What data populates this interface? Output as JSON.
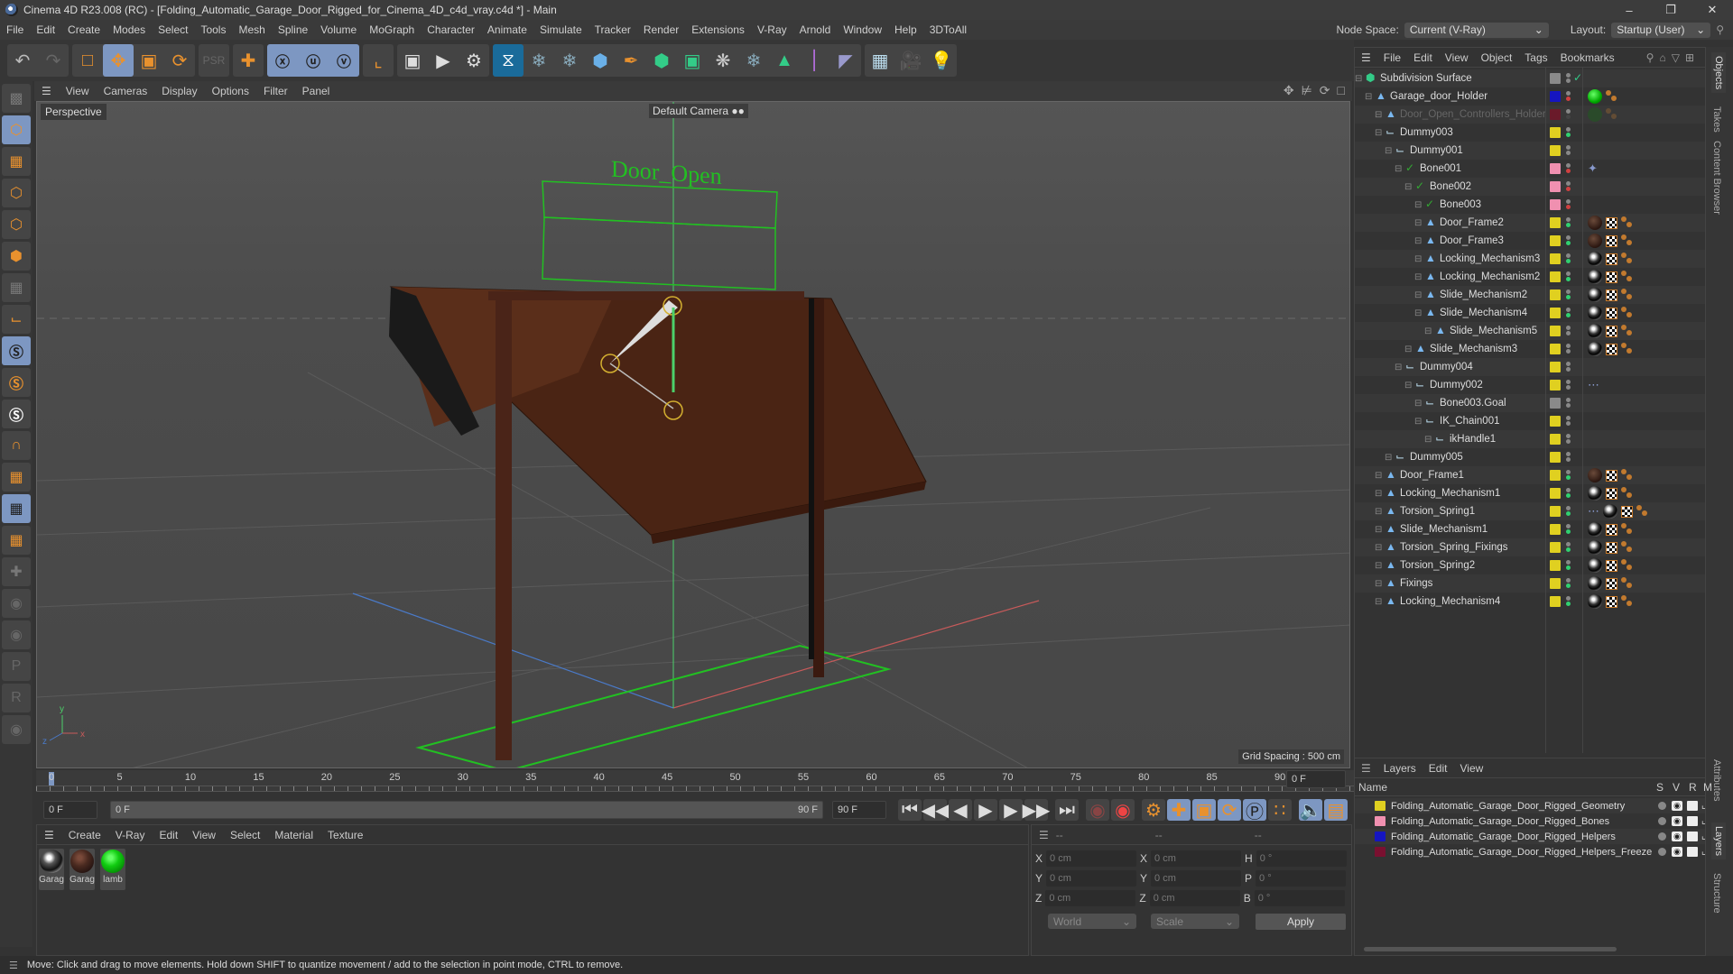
{
  "window": {
    "title": "Cinema 4D R23.008 (RC) - [Folding_Automatic_Garage_Door_Rigged_for_Cinema_4D_c4d_vray.c4d *] - Main",
    "controls": [
      "minimize",
      "restore",
      "close"
    ]
  },
  "menubar": {
    "items": [
      "File",
      "Edit",
      "Create",
      "Modes",
      "Select",
      "Tools",
      "Mesh",
      "Spline",
      "Volume",
      "MoGraph",
      "Character",
      "Animate",
      "Simulate",
      "Tracker",
      "Render",
      "Extensions",
      "V-Ray",
      "Arnold",
      "Window",
      "Help",
      "3DToAll"
    ],
    "node_space_label": "Node Space:",
    "node_space_value": "Current (V-Ray)",
    "layout_label": "Layout:",
    "layout_value": "Startup (User)"
  },
  "toolbar": {
    "icons": [
      "undo-icon",
      "redo-icon",
      "live-selection-icon",
      "move-icon",
      "scale-icon",
      "rotate-icon",
      "psr-icon",
      "coordinate-move-icon",
      "x-axis-icon",
      "y-axis-icon",
      "z-axis-icon",
      "world-coordinates-icon",
      "render-view-icon",
      "render-picture-viewer-icon",
      "render-settings-icon",
      "vray-icon",
      "python-icon",
      "python2-icon",
      "cube-icon",
      "pen-icon",
      "subdivision-icon",
      "extrude-icon",
      "cloner-icon",
      "python3-icon",
      "mograph-icon",
      "deformer-icon",
      "bend-icon",
      "floor-icon",
      "camera-icon",
      "light-icon"
    ]
  },
  "viewport": {
    "menu": [
      "View",
      "Cameras",
      "Display",
      "Options",
      "Filter",
      "Panel"
    ],
    "label": "Perspective",
    "camera_label": "Default Camera",
    "grid_spacing": "Grid Spacing : 500 cm",
    "text_object": "Door_Open"
  },
  "timeline": {
    "ticks": [
      "0",
      "5",
      "10",
      "15",
      "20",
      "25",
      "30",
      "35",
      "40",
      "45",
      "50",
      "55",
      "60",
      "65",
      "70",
      "75",
      "80",
      "85",
      "90"
    ],
    "current_frame": "0 F",
    "start_frame": "0 F",
    "range_start": "0 F",
    "range_end": "90 F",
    "end_frame": "90 F"
  },
  "material_manager": {
    "menu": [
      "Create",
      "V-Ray",
      "Edit",
      "View",
      "Select",
      "Material",
      "Texture"
    ],
    "materials": [
      {
        "label": "Garag",
        "color": "chrome"
      },
      {
        "label": "Garag",
        "color": "brown"
      },
      {
        "label": "lamb",
        "color": "green"
      }
    ]
  },
  "coordinates": {
    "headers": [
      "--",
      "--",
      "--"
    ],
    "rows": [
      {
        "l1": "X",
        "v1": "0 cm",
        "l2": "X",
        "v2": "0 cm",
        "l3": "H",
        "v3": "0 °"
      },
      {
        "l1": "Y",
        "v1": "0 cm",
        "l2": "Y",
        "v2": "0 cm",
        "l3": "P",
        "v3": "0 °"
      },
      {
        "l1": "Z",
        "v1": "0 cm",
        "l2": "Z",
        "v2": "0 cm",
        "l3": "B",
        "v3": "0 °"
      }
    ],
    "space": "World",
    "mode": "Scale",
    "apply": "Apply"
  },
  "object_manager": {
    "menu": [
      "File",
      "Edit",
      "View",
      "Object",
      "Tags",
      "Bookmarks"
    ],
    "objects": [
      {
        "name": "Subdivision Surface",
        "depth": 0,
        "type": "subdiv",
        "swatch": "#8a8a8a",
        "dot": "check",
        "tags": []
      },
      {
        "name": "Garage_door_Holder",
        "depth": 1,
        "type": "null",
        "swatch": "#1515c0",
        "dot": "red",
        "tags": [
          "green",
          "uv"
        ]
      },
      {
        "name": "Door_Open_Controllers_Holder",
        "depth": 2,
        "type": "null",
        "swatch": "#6a1a2a",
        "dot": "dim",
        "tags": [
          "green-dim",
          "uv-dim"
        ],
        "dimmed": true
      },
      {
        "name": "Dummy003",
        "depth": 2,
        "type": "dummy",
        "swatch": "#e0d020",
        "dot": "green",
        "tags": []
      },
      {
        "name": "Dummy001",
        "depth": 3,
        "type": "dummy",
        "swatch": "#e0d020",
        "dot": "grey",
        "tags": []
      },
      {
        "name": "Bone001",
        "depth": 4,
        "type": "bone",
        "swatch": "#f090b0",
        "dot": "red",
        "tags": [
          "ik"
        ]
      },
      {
        "name": "Bone002",
        "depth": 5,
        "type": "bone",
        "swatch": "#f090b0",
        "dot": "red",
        "tags": []
      },
      {
        "name": "Bone003",
        "depth": 6,
        "type": "bone",
        "swatch": "#f090b0",
        "dot": "red",
        "tags": []
      },
      {
        "name": "Door_Frame2",
        "depth": 6,
        "type": "poly",
        "swatch": "#e0d020",
        "dot": "green",
        "tags": [
          "brown",
          "chk",
          "uv"
        ]
      },
      {
        "name": "Door_Frame3",
        "depth": 6,
        "type": "poly",
        "swatch": "#e0d020",
        "dot": "green",
        "tags": [
          "brown",
          "chk",
          "uv"
        ]
      },
      {
        "name": "Locking_Mechanism3",
        "depth": 6,
        "type": "poly",
        "swatch": "#e0d020",
        "dot": "green",
        "tags": [
          "chrome",
          "chk",
          "uv"
        ]
      },
      {
        "name": "Locking_Mechanism2",
        "depth": 6,
        "type": "poly",
        "swatch": "#e0d020",
        "dot": "green",
        "tags": [
          "chrome",
          "chk",
          "uv"
        ]
      },
      {
        "name": "Slide_Mechanism2",
        "depth": 6,
        "type": "poly",
        "swatch": "#e0d020",
        "dot": "green",
        "tags": [
          "chrome",
          "chk",
          "uv"
        ]
      },
      {
        "name": "Slide_Mechanism4",
        "depth": 6,
        "type": "poly",
        "swatch": "#e0d020",
        "dot": "green",
        "tags": [
          "chrome",
          "chk",
          "uv"
        ]
      },
      {
        "name": "Slide_Mechanism5",
        "depth": 7,
        "type": "poly",
        "swatch": "#e0d020",
        "dot": "grey",
        "tags": [
          "chrome",
          "chk",
          "uv"
        ]
      },
      {
        "name": "Slide_Mechanism3",
        "depth": 5,
        "type": "poly",
        "swatch": "#e0d020",
        "dot": "grey",
        "tags": [
          "chrome",
          "chk",
          "uv"
        ]
      },
      {
        "name": "Dummy004",
        "depth": 4,
        "type": "dummy",
        "swatch": "#e0d020",
        "dot": "grey",
        "tags": []
      },
      {
        "name": "Dummy002",
        "depth": 5,
        "type": "dummy",
        "swatch": "#e0d020",
        "dot": "grey",
        "tags": [
          "constraint"
        ]
      },
      {
        "name": "Bone003.Goal",
        "depth": 6,
        "type": "dummy",
        "swatch": "#8a8a8a",
        "dot": "grey",
        "tags": []
      },
      {
        "name": "IK_Chain001",
        "depth": 6,
        "type": "dummy",
        "swatch": "#e0d020",
        "dot": "grey",
        "tags": []
      },
      {
        "name": "ikHandle1",
        "depth": 7,
        "type": "dummy",
        "swatch": "#e0d020",
        "dot": "grey",
        "tags": []
      },
      {
        "name": "Dummy005",
        "depth": 3,
        "type": "dummy",
        "swatch": "#e0d020",
        "dot": "grey",
        "tags": []
      },
      {
        "name": "Door_Frame1",
        "depth": 2,
        "type": "poly",
        "swatch": "#e0d020",
        "dot": "green",
        "tags": [
          "brown",
          "chk",
          "uv"
        ]
      },
      {
        "name": "Locking_Mechanism1",
        "depth": 2,
        "type": "poly",
        "swatch": "#e0d020",
        "dot": "green",
        "tags": [
          "chrome",
          "chk",
          "uv"
        ]
      },
      {
        "name": "Torsion_Spring1",
        "depth": 2,
        "type": "poly",
        "swatch": "#e0d020",
        "dot": "green",
        "tags": [
          "constraint",
          "chrome",
          "chk",
          "uv"
        ]
      },
      {
        "name": "Slide_Mechanism1",
        "depth": 2,
        "type": "poly",
        "swatch": "#e0d020",
        "dot": "green",
        "tags": [
          "chrome",
          "chk",
          "uv"
        ]
      },
      {
        "name": "Torsion_Spring_Fixings",
        "depth": 2,
        "type": "poly",
        "swatch": "#e0d020",
        "dot": "green",
        "tags": [
          "chrome",
          "chk",
          "uv"
        ]
      },
      {
        "name": "Torsion_Spring2",
        "depth": 2,
        "type": "poly",
        "swatch": "#e0d020",
        "dot": "green",
        "tags": [
          "chrome",
          "chk",
          "uv"
        ]
      },
      {
        "name": "Fixings",
        "depth": 2,
        "type": "poly",
        "swatch": "#e0d020",
        "dot": "green",
        "tags": [
          "chrome",
          "chk",
          "uv"
        ]
      },
      {
        "name": "Locking_Mechanism4",
        "depth": 2,
        "type": "poly",
        "swatch": "#e0d020",
        "dot": "green",
        "tags": [
          "chrome",
          "chk",
          "uv"
        ]
      }
    ]
  },
  "right_tabs": [
    "Objects",
    "Takes",
    "Content Browser",
    "Attributes",
    "Layers",
    "Structure"
  ],
  "layer_manager": {
    "menu": [
      "Layers",
      "Edit",
      "View"
    ],
    "columns": [
      "Name",
      "S",
      "V",
      "R",
      "M"
    ],
    "layers": [
      {
        "name": "Folding_Automatic_Garage_Door_Rigged_Geometry",
        "color": "#e0d020"
      },
      {
        "name": "Folding_Automatic_Garage_Door_Rigged_Bones",
        "color": "#f090b0"
      },
      {
        "name": "Folding_Automatic_Garage_Door_Rigged_Helpers",
        "color": "#1515c0"
      },
      {
        "name": "Folding_Automatic_Garage_Door_Rigged_Helpers_Freeze",
        "color": "#7a1030"
      }
    ]
  },
  "statusbar": {
    "text": "Move: Click and drag to move elements. Hold down SHIFT to quantize movement / add to the selection in point mode, CTRL to remove."
  }
}
